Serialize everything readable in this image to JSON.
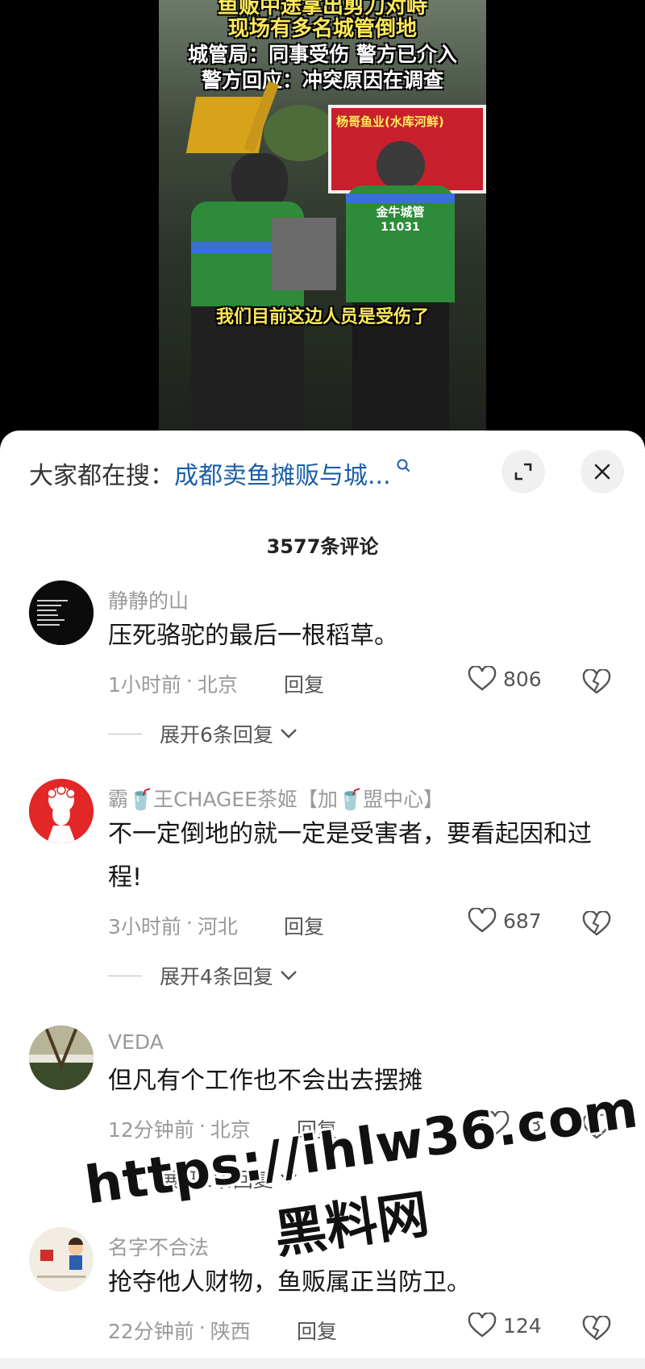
{
  "video": {
    "captions": [
      "鱼贩中途拿出剪刀对峙",
      "现场有多名城管倒地",
      "城管局：同事受伤 警方已介入",
      "警方回应：冲突原因在调查"
    ],
    "banner_text": "杨哥鱼业(水库河鲜)",
    "vest_text": "金牛城管",
    "vest_number": "11031",
    "subtitle": "我们目前这边人员是受伤了"
  },
  "search": {
    "prefix": "大家都在搜：",
    "query": "成都卖鱼摊贩与城...",
    "expand_icon": "expand-icon",
    "close_icon": "close-icon"
  },
  "comment_count": "3577条评论",
  "comments": [
    {
      "username": "静静的山",
      "text": "压死骆驼的最后一根稻草。",
      "time": "1小时前",
      "location": "北京",
      "reply": "回复",
      "likes": "806",
      "expand": "展开6条回复"
    },
    {
      "username": "霸🥤王CHAGEE茶姬【加🥤盟中心】",
      "text": "不一定倒地的就一定是受害者，要看起因和过程!",
      "time": "3小时前",
      "location": "河北",
      "reply": "回复",
      "likes": "687",
      "expand": "展开4条回复"
    },
    {
      "username": "VEDA",
      "text": "但凡有个工作也不会出去摆摊",
      "time": "12分钟前",
      "location": "北京",
      "reply": "回复",
      "likes": "63",
      "expand": "展开1条回复"
    },
    {
      "username": "名字不合法",
      "text": "抢夺他人财物，鱼贩属正当防卫。",
      "time": "22分钟前",
      "location": "陕西",
      "reply": "回复",
      "likes": "124"
    }
  ],
  "watermark": {
    "url": "https://ihlw36.com",
    "name": "黑料网"
  },
  "colors": {
    "link": "#1b5fa8",
    "meta": "#9a9a9a",
    "vest": "#2e8b3a"
  }
}
